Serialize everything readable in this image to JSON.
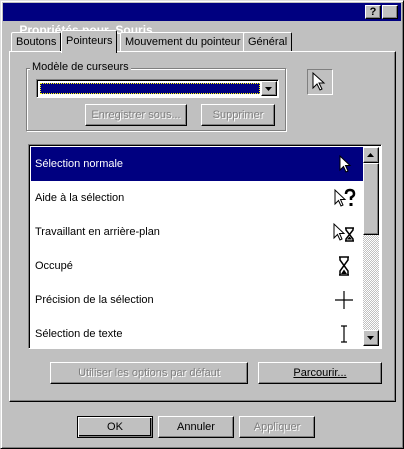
{
  "window": {
    "title": "Propriétés pour  Souris",
    "help_label": "?",
    "close_label": "×"
  },
  "tabs": [
    {
      "label": "Boutons",
      "active": false
    },
    {
      "label": "Pointeurs",
      "active": true
    },
    {
      "label": "Mouvement du pointeur",
      "active": false
    },
    {
      "label": "Général",
      "active": false
    }
  ],
  "scheme": {
    "group_label": "Modèle de curseurs",
    "selected_value": "",
    "save_as_label": "Enregistrer sous...",
    "delete_label": "Supprimer"
  },
  "cursors": {
    "items": [
      {
        "label": "Sélection normale",
        "icon": "arrow-cursor-icon",
        "selected": true
      },
      {
        "label": "Aide à la sélection",
        "icon": "help-select-cursor-icon",
        "selected": false
      },
      {
        "label": "Travaillant en arrière-plan",
        "icon": "working-background-cursor-icon",
        "selected": false
      },
      {
        "label": "Occupé",
        "icon": "hourglass-cursor-icon",
        "selected": false
      },
      {
        "label": "Précision de la sélection",
        "icon": "crosshair-cursor-icon",
        "selected": false
      },
      {
        "label": "Sélection de texte",
        "icon": "text-beam-cursor-icon",
        "selected": false
      }
    ]
  },
  "actions": {
    "use_default_label": "Utiliser les options par défaut",
    "browse_label": "Parcourir..."
  },
  "dialog_buttons": {
    "ok_label": "OK",
    "cancel_label": "Annuler",
    "apply_label": "Appliquer"
  },
  "colors": {
    "face": "#c0c0c0",
    "title_bar": "#000080",
    "selection": "#000080"
  }
}
